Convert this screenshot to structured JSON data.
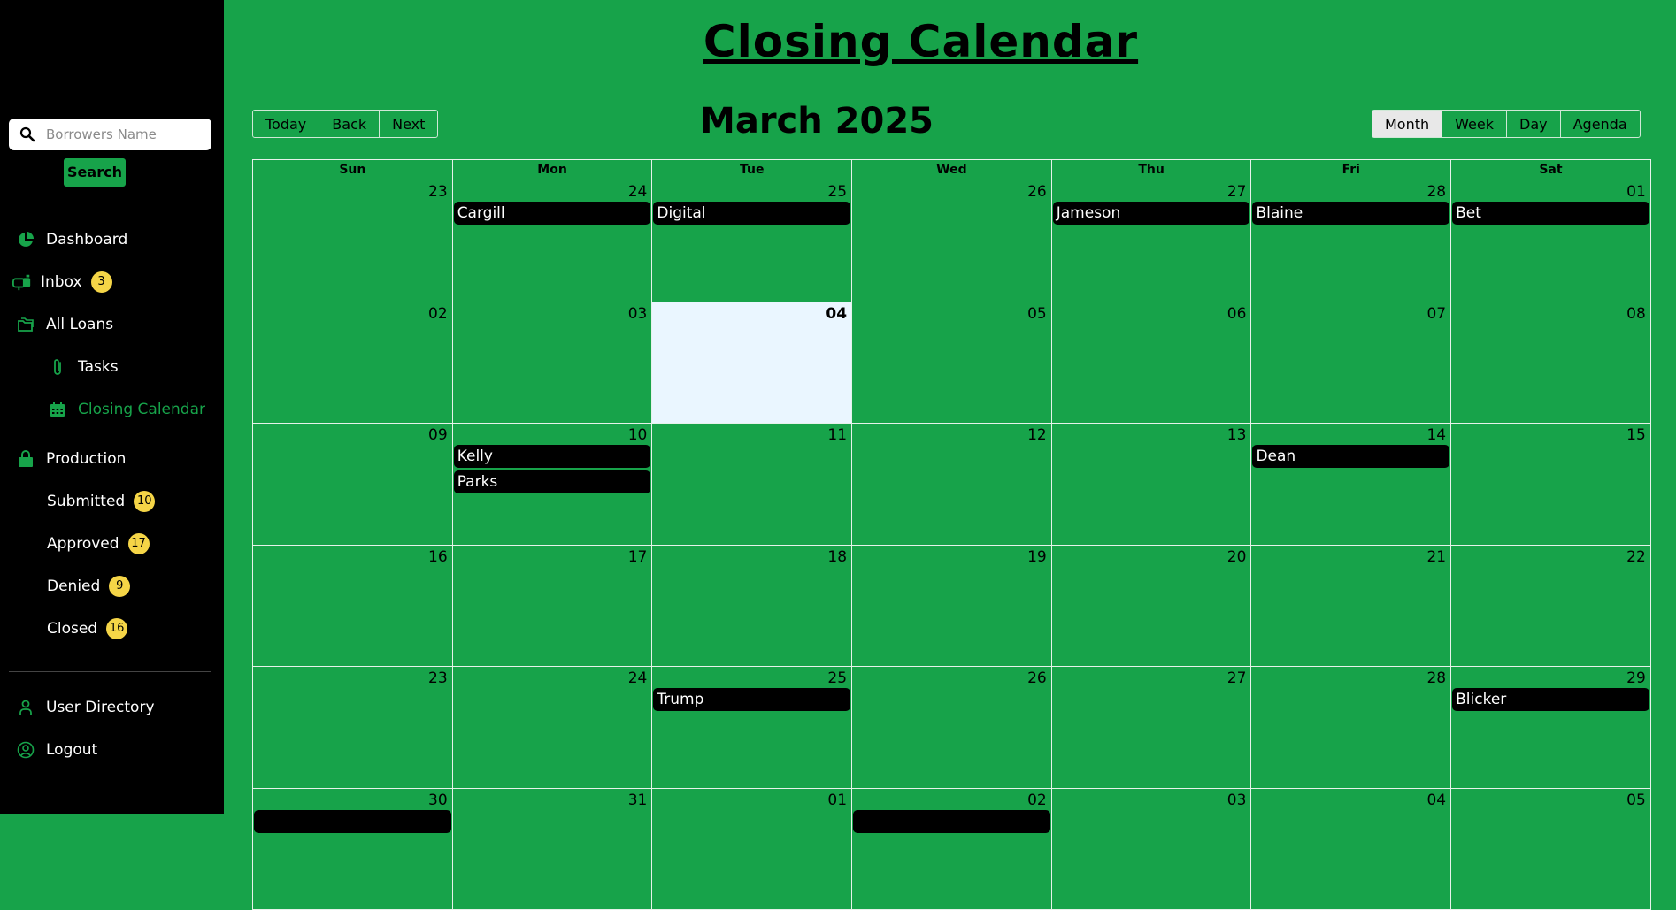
{
  "sidebar": {
    "search_placeholder": "Borrowers Name",
    "search_button": "Search",
    "nav": {
      "dashboard": "Dashboard",
      "inbox": "Inbox",
      "inbox_count": "3",
      "all_loans": "All Loans",
      "tasks": "Tasks",
      "closing_calendar": "Closing Calendar",
      "production": "Production",
      "submitted": "Submitted",
      "submitted_count": "10",
      "approved": "Approved",
      "approved_count": "17",
      "denied": "Denied",
      "denied_count": "9",
      "closed": "Closed",
      "closed_count": "16",
      "user_directory": "User Directory",
      "logout": "Logout"
    }
  },
  "colors": {
    "accent": "#17a34a",
    "badge": "#f5d547",
    "sidebar_bg": "#000000",
    "today_bg": "#eaf6ff"
  },
  "page_title": "Closing Calendar",
  "toolbar": {
    "today": "Today",
    "back": "Back",
    "next": "Next",
    "month_label": "March 2025",
    "views": {
      "month": "Month",
      "week": "Week",
      "day": "Day",
      "agenda": "Agenda"
    },
    "active_view": "Month"
  },
  "calendar": {
    "weekdays": [
      "Sun",
      "Mon",
      "Tue",
      "Wed",
      "Thu",
      "Fri",
      "Sat"
    ],
    "today": "04",
    "weeks": [
      [
        {
          "num": "23",
          "events": []
        },
        {
          "num": "24",
          "events": [
            "Cargill"
          ]
        },
        {
          "num": "25",
          "events": [
            "Digital"
          ]
        },
        {
          "num": "26",
          "events": []
        },
        {
          "num": "27",
          "events": [
            "Jameson"
          ]
        },
        {
          "num": "28",
          "events": [
            "Blaine"
          ]
        },
        {
          "num": "01",
          "events": [
            "Bet"
          ]
        }
      ],
      [
        {
          "num": "02",
          "events": []
        },
        {
          "num": "03",
          "events": []
        },
        {
          "num": "04",
          "events": [],
          "today": true
        },
        {
          "num": "05",
          "events": []
        },
        {
          "num": "06",
          "events": []
        },
        {
          "num": "07",
          "events": []
        },
        {
          "num": "08",
          "events": []
        }
      ],
      [
        {
          "num": "09",
          "events": []
        },
        {
          "num": "10",
          "events": [
            "Kelly",
            "Parks"
          ]
        },
        {
          "num": "11",
          "events": []
        },
        {
          "num": "12",
          "events": []
        },
        {
          "num": "13",
          "events": []
        },
        {
          "num": "14",
          "events": [
            "Dean"
          ]
        },
        {
          "num": "15",
          "events": []
        }
      ],
      [
        {
          "num": "16",
          "events": []
        },
        {
          "num": "17",
          "events": []
        },
        {
          "num": "18",
          "events": []
        },
        {
          "num": "19",
          "events": []
        },
        {
          "num": "20",
          "events": []
        },
        {
          "num": "21",
          "events": []
        },
        {
          "num": "22",
          "events": []
        }
      ],
      [
        {
          "num": "23",
          "events": []
        },
        {
          "num": "24",
          "events": []
        },
        {
          "num": "25",
          "events": [
            "Trump"
          ]
        },
        {
          "num": "26",
          "events": []
        },
        {
          "num": "27",
          "events": []
        },
        {
          "num": "28",
          "events": []
        },
        {
          "num": "29",
          "events": [
            "Blicker"
          ]
        }
      ],
      [
        {
          "num": "30",
          "events": [
            ""
          ]
        },
        {
          "num": "31",
          "events": []
        },
        {
          "num": "01",
          "events": []
        },
        {
          "num": "02",
          "events": [
            ""
          ]
        },
        {
          "num": "03",
          "events": []
        },
        {
          "num": "04",
          "events": []
        },
        {
          "num": "05",
          "events": []
        }
      ]
    ]
  }
}
